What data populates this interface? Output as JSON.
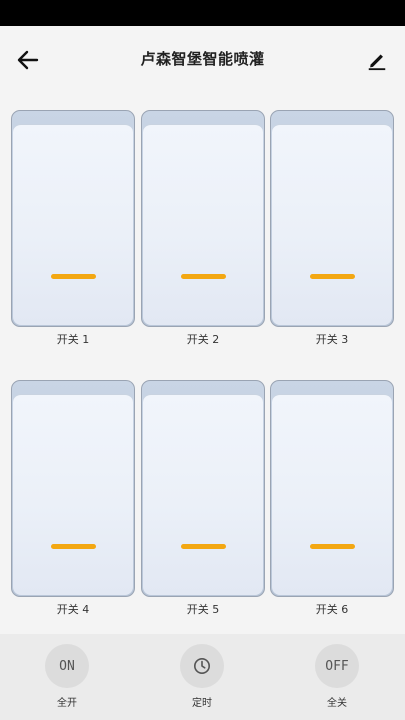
{
  "header": {
    "title": "卢森智堡智能喷灌"
  },
  "switches": [
    {
      "label": "开关 1"
    },
    {
      "label": "开关 2"
    },
    {
      "label": "开关 3"
    },
    {
      "label": "开关 4"
    },
    {
      "label": "开关 5"
    },
    {
      "label": "开关 6"
    }
  ],
  "bottom_actions": {
    "all_on": {
      "icon_text": "ON",
      "label": "全开"
    },
    "timer": {
      "icon": "clock-icon",
      "label": "定时"
    },
    "all_off": {
      "icon_text": "OFF",
      "label": "全关"
    }
  },
  "colors": {
    "indicator": "#f3a712",
    "background": "#f4f4f4",
    "bottom_bar": "#ebebeb"
  }
}
